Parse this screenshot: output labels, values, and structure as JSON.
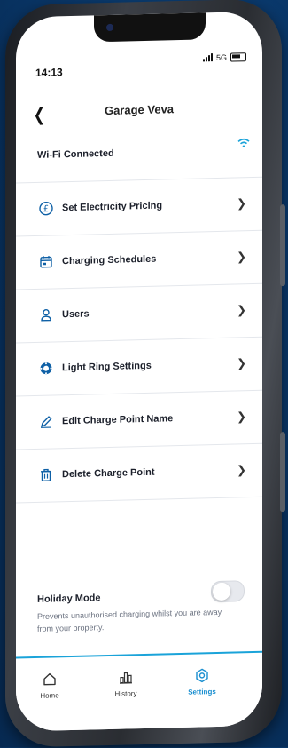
{
  "status_bar": {
    "time": "14:13",
    "network": "5G"
  },
  "header": {
    "title": "Garage Veva"
  },
  "wifi": {
    "label": "Wi-Fi Connected",
    "icon": "wifi-icon"
  },
  "menu": [
    {
      "label": "Set Electricity Pricing",
      "icon": "pound-icon"
    },
    {
      "label": "Charging Schedules",
      "icon": "calendar-icon"
    },
    {
      "label": "Users",
      "icon": "user-icon"
    },
    {
      "label": "Light Ring Settings",
      "icon": "light-ring-icon"
    },
    {
      "label": "Edit Charge Point Name",
      "icon": "pencil-icon"
    },
    {
      "label": "Delete Charge Point",
      "icon": "trash-icon"
    }
  ],
  "holiday": {
    "title": "Holiday Mode",
    "description": "Prevents unauthorised charging whilst you are away from your property.",
    "enabled": false
  },
  "tabs": [
    {
      "label": "Home",
      "icon": "home-icon",
      "active": false
    },
    {
      "label": "History",
      "icon": "bar-chart-icon",
      "active": false
    },
    {
      "label": "Settings",
      "icon": "settings-icon",
      "active": true
    }
  ],
  "colors": {
    "accent": "#1a8fd0",
    "icon": "#0e60a6",
    "wifi": "#1aa3d9",
    "background": "#0a3a6e"
  }
}
